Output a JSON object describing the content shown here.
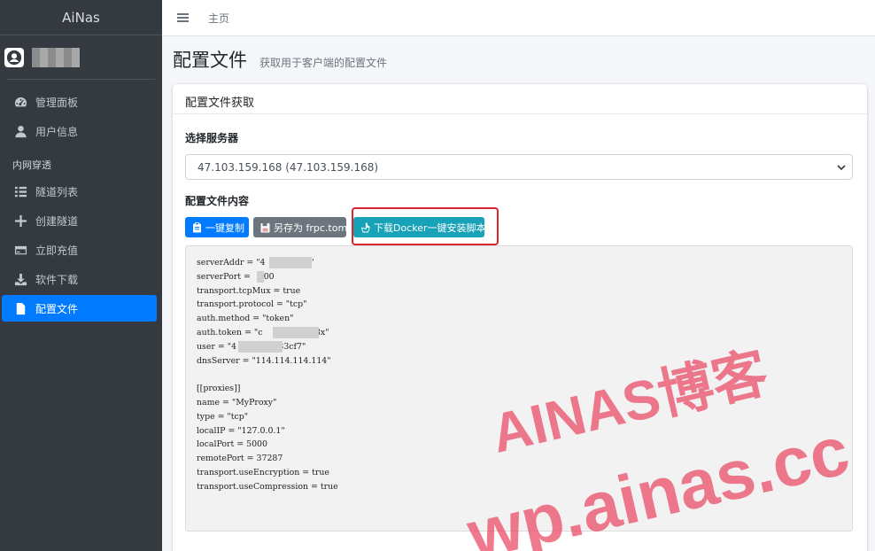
{
  "brand": "AiNas",
  "sidebar": {
    "items_top": [
      {
        "label": "管理面板",
        "icon": "dashboard-icon"
      },
      {
        "label": "用户信息",
        "icon": "user-icon"
      }
    ],
    "section_header": "内网穿透",
    "items_bottom": [
      {
        "label": "隧道列表",
        "icon": "list-icon"
      },
      {
        "label": "创建隧道",
        "icon": "plus-icon"
      },
      {
        "label": "立即充值",
        "icon": "credit-card-icon"
      },
      {
        "label": "软件下载",
        "icon": "download-icon"
      },
      {
        "label": "配置文件",
        "icon": "file-icon"
      }
    ]
  },
  "topbar": {
    "home": "主页"
  },
  "page": {
    "title": "配置文件",
    "subtitle": "获取用于客户端的配置文件"
  },
  "card": {
    "header": "配置文件获取",
    "server_label": "选择服务器",
    "server_selected": "47.103.159.168 (47.103.159.168)",
    "content_label": "配置文件内容",
    "buttons": {
      "copy": "一键复制",
      "save": "另存为 frpc.toml",
      "docker": "下载Docker一键安装脚本"
    },
    "config_lines": [
      "serverAddr = \"4          .168\"",
      "serverPort =     00",
      "transport.tcpMux = true",
      "transport.protocol = \"tcp\"",
      "auth.method = \"token\"",
      "auth.token = \"c         63rznx3x\"",
      "user = \"4        4dba33cf7\"",
      "dnsServer = \"114.114.114.114\"",
      "",
      "[[proxies]]",
      "name = \"MyProxy\"",
      "type = \"tcp\"",
      "localIP = \"127.0.0.1\"",
      "localPort = 5000",
      "remotePort = 37287",
      "transport.useEncryption = true",
      "transport.useCompression = true"
    ]
  },
  "watermark": {
    "line1": "AINAS博客",
    "line2": "wp.ainas.cc"
  },
  "colors": {
    "sidebar_bg": "#343a40",
    "active": "#007bff",
    "info": "#17a2b8",
    "secondary": "#6c757d",
    "highlight": "#d9262c",
    "watermark": "#eb556e"
  }
}
